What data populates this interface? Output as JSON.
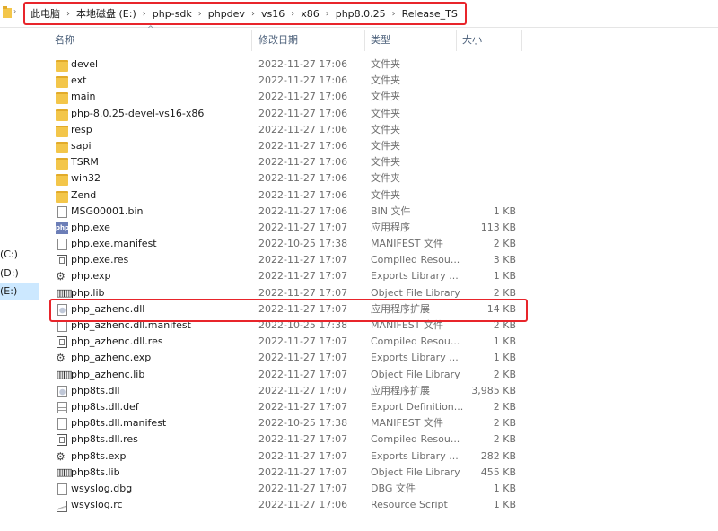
{
  "address": {
    "crumbs": [
      "此电脑",
      "本地磁盘 (E:)",
      "php-sdk",
      "phpdev",
      "vs16",
      "x86",
      "php8.0.25",
      "Release_TS"
    ]
  },
  "nav": {
    "items": [
      {
        "label": "(C:)",
        "selected": false
      },
      {
        "label": "(D:)",
        "selected": false
      },
      {
        "label": "(E:)",
        "selected": true
      }
    ]
  },
  "columns": {
    "name": "名称",
    "date": "修改日期",
    "type": "类型",
    "size": "大小"
  },
  "files": [
    {
      "name": "devel",
      "date": "2022-11-27 17:06",
      "type": "文件夹",
      "size": "",
      "icon": "folder-icon"
    },
    {
      "name": "ext",
      "date": "2022-11-27 17:06",
      "type": "文件夹",
      "size": "",
      "icon": "folder-icon"
    },
    {
      "name": "main",
      "date": "2022-11-27 17:06",
      "type": "文件夹",
      "size": "",
      "icon": "folder-icon"
    },
    {
      "name": "php-8.0.25-devel-vs16-x86",
      "date": "2022-11-27 17:06",
      "type": "文件夹",
      "size": "",
      "icon": "folder-icon"
    },
    {
      "name": "resp",
      "date": "2022-11-27 17:06",
      "type": "文件夹",
      "size": "",
      "icon": "folder-icon"
    },
    {
      "name": "sapi",
      "date": "2022-11-27 17:06",
      "type": "文件夹",
      "size": "",
      "icon": "folder-icon"
    },
    {
      "name": "TSRM",
      "date": "2022-11-27 17:06",
      "type": "文件夹",
      "size": "",
      "icon": "folder-icon"
    },
    {
      "name": "win32",
      "date": "2022-11-27 17:06",
      "type": "文件夹",
      "size": "",
      "icon": "folder-icon"
    },
    {
      "name": "Zend",
      "date": "2022-11-27 17:06",
      "type": "文件夹",
      "size": "",
      "icon": "folder-icon"
    },
    {
      "name": "MSG00001.bin",
      "date": "2022-11-27 17:06",
      "type": "BIN 文件",
      "size": "1 KB",
      "icon": "blank-file-icon"
    },
    {
      "name": "php.exe",
      "date": "2022-11-27 17:07",
      "type": "应用程序",
      "size": "113 KB",
      "icon": "php-exe-icon"
    },
    {
      "name": "php.exe.manifest",
      "date": "2022-10-25 17:38",
      "type": "MANIFEST 文件",
      "size": "2 KB",
      "icon": "blank-file-icon"
    },
    {
      "name": "php.exe.res",
      "date": "2022-11-27 17:07",
      "type": "Compiled Resou...",
      "size": "3 KB",
      "icon": "res-file-icon"
    },
    {
      "name": "php.exp",
      "date": "2022-11-27 17:07",
      "type": "Exports Library ...",
      "size": "1 KB",
      "icon": "exp-file-icon"
    },
    {
      "name": "php.lib",
      "date": "2022-11-27 17:07",
      "type": "Object File Library",
      "size": "2 KB",
      "icon": "lib-file-icon"
    },
    {
      "name": "php_azhenc.dll",
      "date": "2022-11-27 17:07",
      "type": "应用程序扩展",
      "size": "14 KB",
      "icon": "dll-file-icon"
    },
    {
      "name": "php_azhenc.dll.manifest",
      "date": "2022-10-25 17:38",
      "type": "MANIFEST 文件",
      "size": "2 KB",
      "icon": "blank-file-icon"
    },
    {
      "name": "php_azhenc.dll.res",
      "date": "2022-11-27 17:07",
      "type": "Compiled Resou...",
      "size": "1 KB",
      "icon": "res-file-icon"
    },
    {
      "name": "php_azhenc.exp",
      "date": "2022-11-27 17:07",
      "type": "Exports Library ...",
      "size": "1 KB",
      "icon": "exp-file-icon"
    },
    {
      "name": "php_azhenc.lib",
      "date": "2022-11-27 17:07",
      "type": "Object File Library",
      "size": "2 KB",
      "icon": "lib-file-icon"
    },
    {
      "name": "php8ts.dll",
      "date": "2022-11-27 17:07",
      "type": "应用程序扩展",
      "size": "3,985 KB",
      "icon": "dll-file-icon"
    },
    {
      "name": "php8ts.dll.def",
      "date": "2022-11-27 17:07",
      "type": "Export Definition...",
      "size": "2 KB",
      "icon": "text-file-icon"
    },
    {
      "name": "php8ts.dll.manifest",
      "date": "2022-10-25 17:38",
      "type": "MANIFEST 文件",
      "size": "2 KB",
      "icon": "blank-file-icon"
    },
    {
      "name": "php8ts.dll.res",
      "date": "2022-11-27 17:07",
      "type": "Compiled Resou...",
      "size": "2 KB",
      "icon": "res-file-icon"
    },
    {
      "name": "php8ts.exp",
      "date": "2022-11-27 17:07",
      "type": "Exports Library ...",
      "size": "282 KB",
      "icon": "exp-file-icon"
    },
    {
      "name": "php8ts.lib",
      "date": "2022-11-27 17:07",
      "type": "Object File Library",
      "size": "455 KB",
      "icon": "lib-file-icon"
    },
    {
      "name": "wsyslog.dbg",
      "date": "2022-11-27 17:07",
      "type": "DBG 文件",
      "size": "1 KB",
      "icon": "blank-file-icon"
    },
    {
      "name": "wsyslog.rc",
      "date": "2022-11-27 17:06",
      "type": "Resource Script",
      "size": "1 KB",
      "icon": "image-file-icon"
    }
  ],
  "colors": {
    "highlight": "#e8252b",
    "folder": "#f3c64a",
    "header_text": "#4c607a",
    "nav_selected": "#cce8ff"
  }
}
